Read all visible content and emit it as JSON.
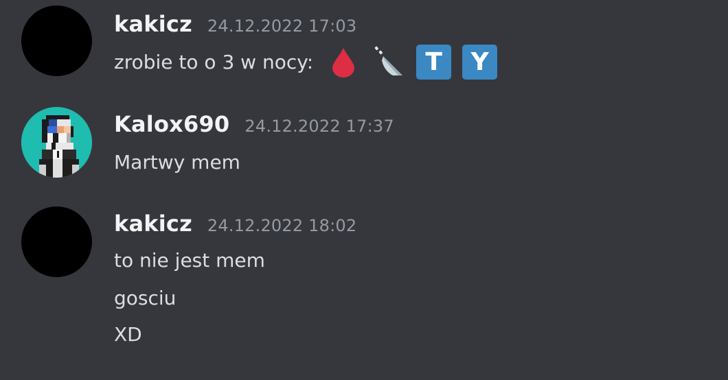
{
  "messages": [
    {
      "username": "kakicz",
      "timestamp": "24.12.2022 17:03",
      "lines": [
        "zrobie to o 3 w nocy:"
      ],
      "emojis": [
        "drop-of-blood-icon",
        "kitchen-knife-icon",
        "T",
        "Y"
      ]
    },
    {
      "username": "Kalox690",
      "timestamp": "24.12.2022 17:37",
      "lines": [
        "Martwy mem"
      ]
    },
    {
      "username": "kakicz",
      "timestamp": "24.12.2022 18:02",
      "lines": [
        "to nie jest mem",
        "gosciu",
        "XD"
      ]
    }
  ],
  "colors": {
    "background": "#36373d",
    "username": "#f2f3f5",
    "timestamp": "#949ba4",
    "text": "#dbdee1",
    "regional_indicator": "#3b88c3"
  }
}
